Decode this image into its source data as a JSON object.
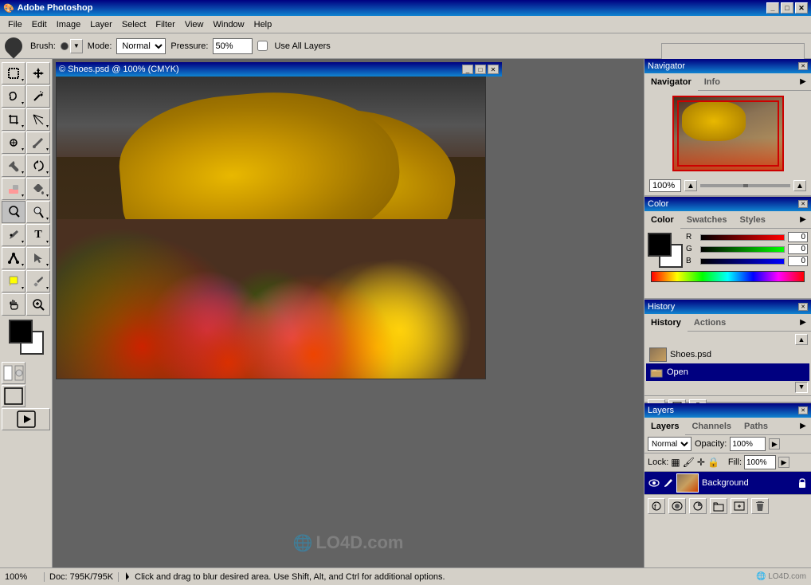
{
  "app": {
    "title": "Adobe Photoshop",
    "title_icon": "ps-icon"
  },
  "window_controls": {
    "minimize": "_",
    "maximize": "□",
    "close": "✕"
  },
  "menu": {
    "items": [
      "File",
      "Edit",
      "Image",
      "Layer",
      "Select",
      "Filter",
      "View",
      "Window",
      "Help"
    ]
  },
  "options_bar": {
    "brush_label": "Brush:",
    "mode_label": "Mode:",
    "mode_value": "Normal",
    "pressure_label": "Pressure:",
    "pressure_value": "50%",
    "use_all_layers": "Use All Layers"
  },
  "document": {
    "title": "© Shoes.psd @ 100% (CMYK)"
  },
  "navigator": {
    "tab_active": "Navigator",
    "tab_info": "Info",
    "zoom_value": "100%"
  },
  "color": {
    "tab_active": "Color",
    "tab_swatches": "Swatches",
    "tab_styles": "Styles",
    "r_label": "R",
    "g_label": "G",
    "b_label": "B",
    "r_value": "0",
    "g_value": "0",
    "b_value": "0"
  },
  "history": {
    "tab_active": "History",
    "tab_actions": "Actions",
    "items": [
      {
        "name": "Shoes.psd",
        "type": "file"
      },
      {
        "name": "Open",
        "type": "action",
        "selected": true
      }
    ]
  },
  "layers": {
    "tab_active": "Layers",
    "tab_channels": "Channels",
    "tab_paths": "Paths",
    "mode_value": "Normal",
    "opacity_value": "100%",
    "opacity_label": "Opacity:",
    "lock_label": "Lock:",
    "layer_name": "Background"
  },
  "status_bar": {
    "zoom": "100%",
    "doc_info": "Doc: 795K/795K",
    "hint": "Click and drag to blur desired area. Use Shift, Alt, and Ctrl for additional options."
  },
  "watermark": {
    "text": "LO4D.com",
    "symbol": "🌐"
  }
}
